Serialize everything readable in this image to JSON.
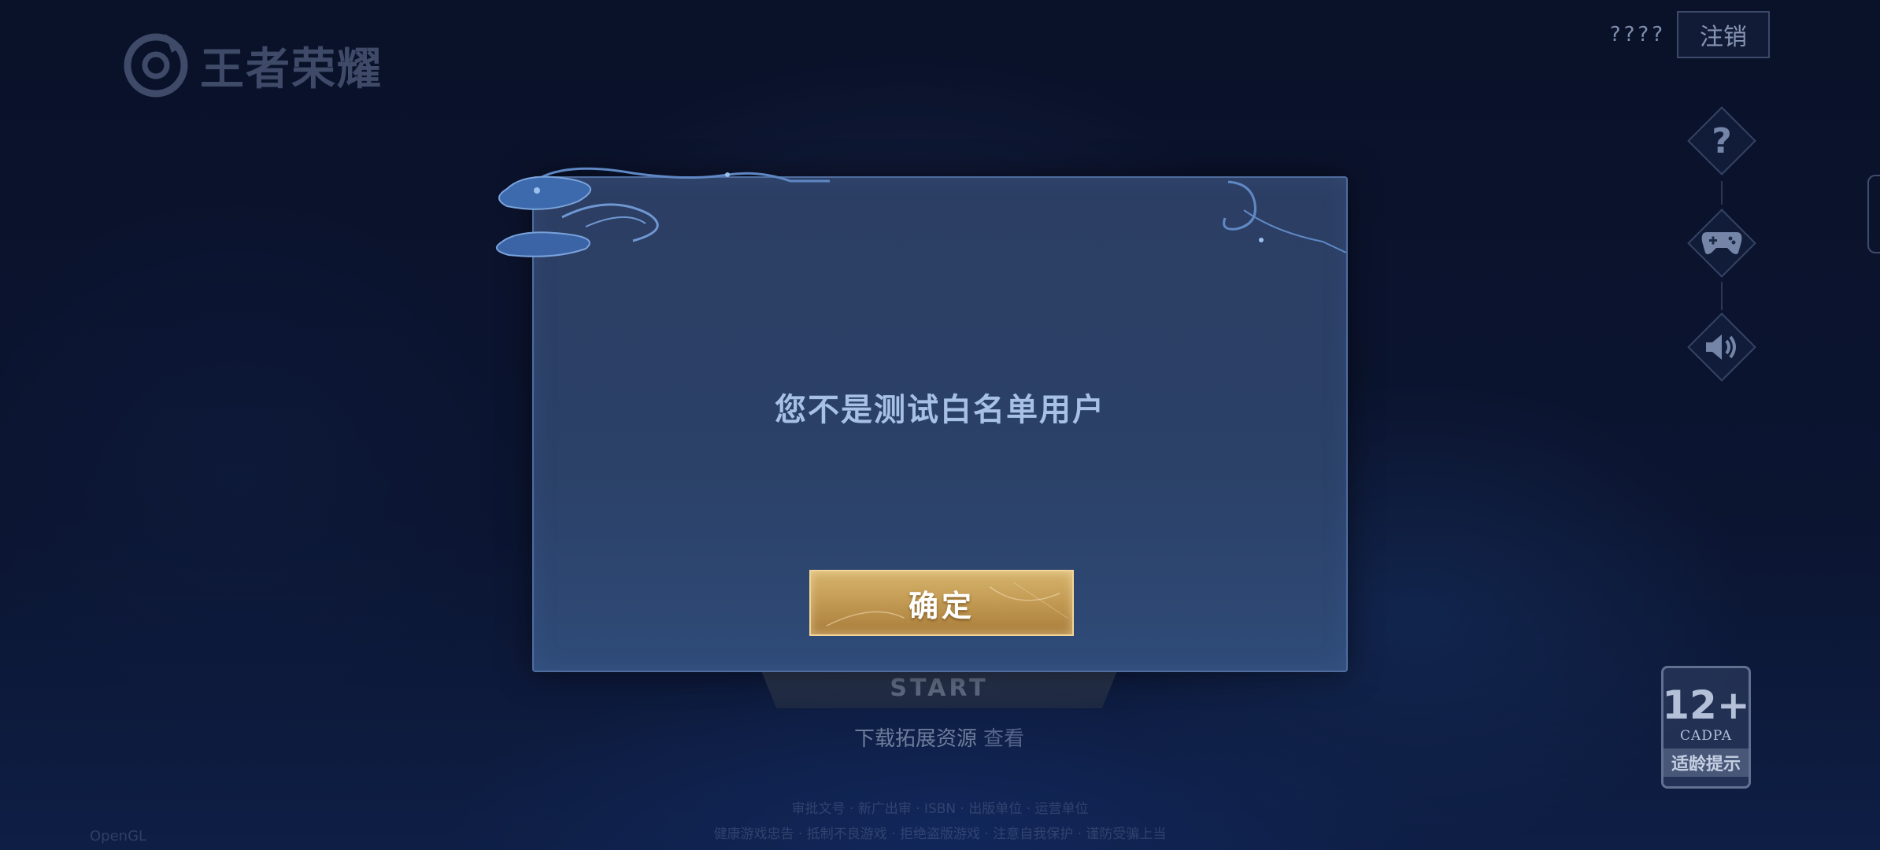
{
  "app": {
    "logo_text": "王者荣耀"
  },
  "header": {
    "account_mask": "????",
    "logout_label": "注销"
  },
  "side_menu": {
    "icons": [
      "help-icon",
      "gamepad-icon",
      "speaker-icon"
    ]
  },
  "start_button": {
    "label": "START"
  },
  "download": {
    "text": "下载拓展资源",
    "link": "查看"
  },
  "age_rating": {
    "age": "12+",
    "org": "CADPA",
    "tip": "适龄提示"
  },
  "dialog": {
    "message": "您不是测试白名单用户",
    "confirm_label": "确定"
  },
  "colors": {
    "dialog_bg": "#2c3e63",
    "dialog_border": "#4f6c9e",
    "message_text": "#a7c0e6",
    "confirm_gold": "#c49c55"
  }
}
